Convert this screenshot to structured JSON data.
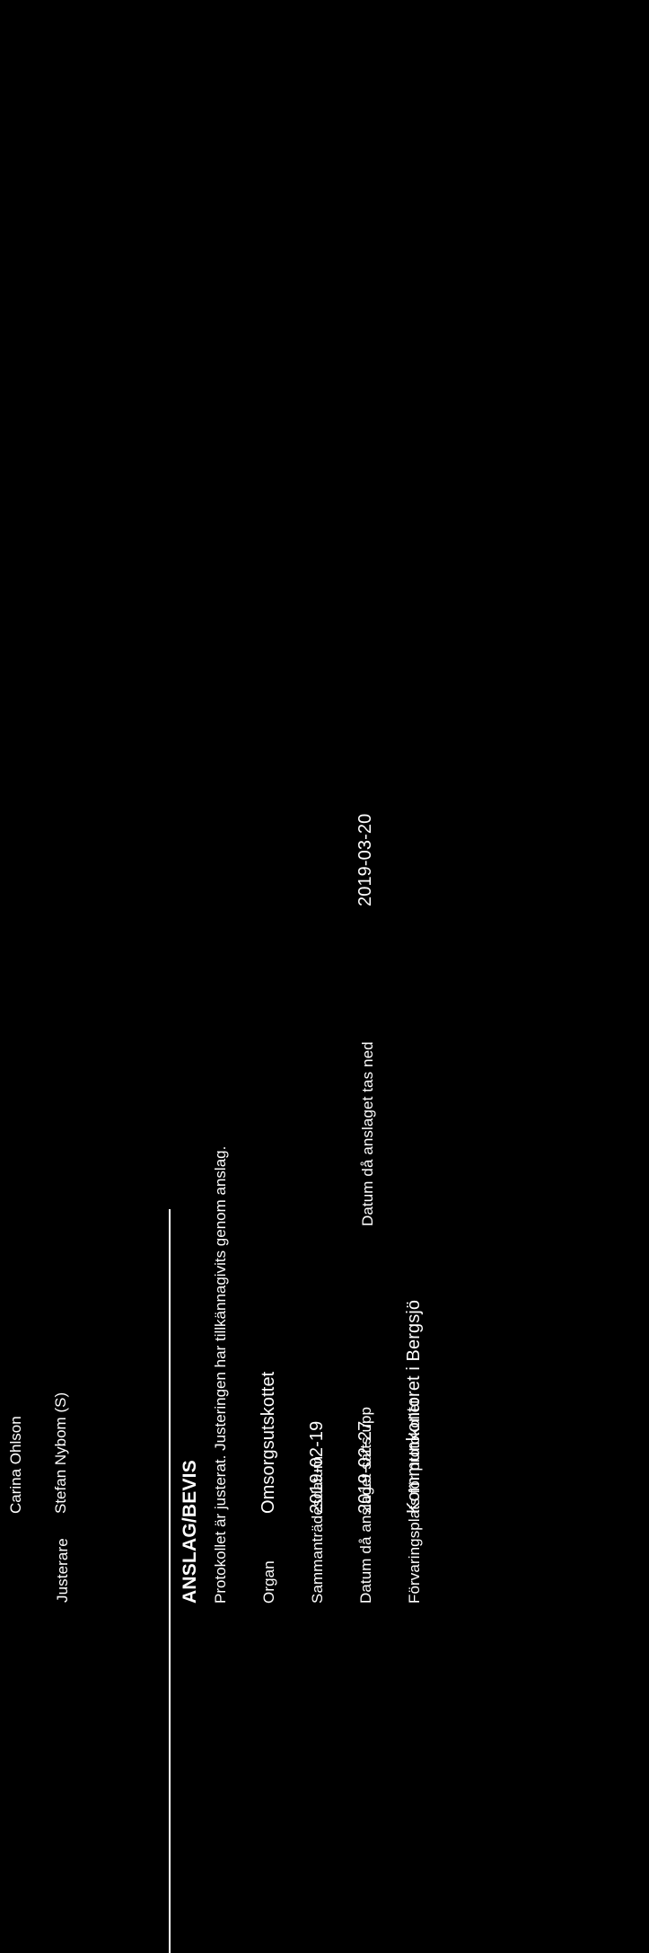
{
  "document": {
    "signature_name": "Carina Ohlson",
    "rows": {
      "justerare": {
        "label": "Justerare",
        "value": "Stefan Nybom (S)"
      },
      "anslag": {
        "heading": "ANSLAG/BEVIS",
        "text": "Protokollet är justerat. Justeringen har tillkännagivits genom anslag."
      },
      "organ": {
        "label": "Organ",
        "value": "Omsorgsutskottet"
      },
      "sammantradesdatum": {
        "label": "Sammanträdesdatum",
        "value": "2019-02-19"
      },
      "anslag_upp": {
        "label": "Datum då anslaget sätts upp",
        "value": "2019-02-27"
      },
      "anslag_ned": {
        "label": "Datum då anslaget tas ned",
        "value": "2019-03-20"
      },
      "forvaringsplats": {
        "label": "Förvaringsplats för protokollet",
        "value": "Kommunkontoret i Bergsjö"
      }
    }
  },
  "colors": {
    "background": "#000000",
    "foreground": "#ffffff"
  }
}
